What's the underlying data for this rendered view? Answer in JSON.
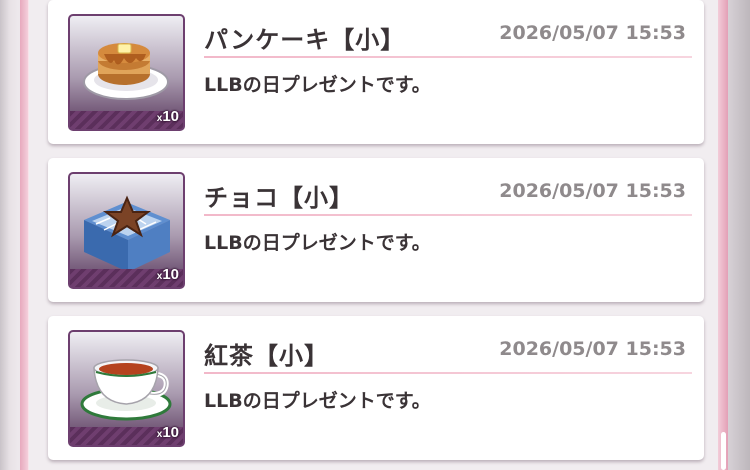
{
  "items": [
    {
      "name": "パンケーキ【小】",
      "date": "2026/05/07 15:53",
      "message": "LLBの日プレゼントです。",
      "qty_prefix": "x",
      "qty_value": "10",
      "icon": "pancake-icon"
    },
    {
      "name": "チョコ【小】",
      "date": "2026/05/07 15:53",
      "message": "LLBの日プレゼントです。",
      "qty_prefix": "x",
      "qty_value": "10",
      "icon": "chocolate-icon"
    },
    {
      "name": "紅茶【小】",
      "date": "2026/05/07 15:53",
      "message": "LLBの日プレゼントです。",
      "qty_prefix": "x",
      "qty_value": "10",
      "icon": "tea-cup-icon"
    }
  ],
  "colors": {
    "frame_pink": "#e7a9bd",
    "divider_pink": "#f2b8c9",
    "thumb_border": "#6d3f6f",
    "title_text": "#3a3336",
    "date_text": "#8f8a8c"
  }
}
